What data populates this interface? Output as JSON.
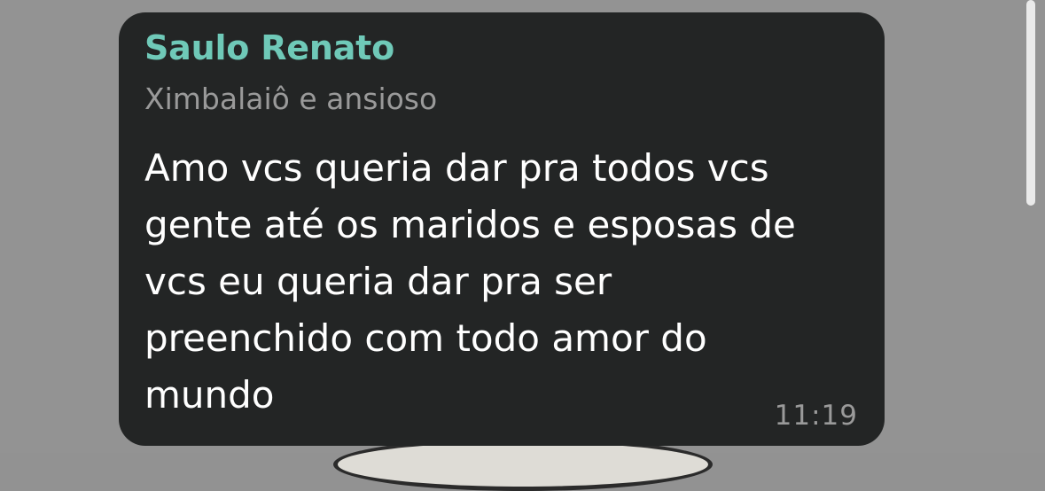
{
  "message": {
    "sender_name": "Saulo Renato",
    "sender_status": "Ximbalaiô e ansioso",
    "body_lines": [
      "Amo vcs queria dar pra todos vcs",
      "gente até os maridos e esposas de",
      "vcs eu queria dar pra ser",
      "preenchido com todo amor do",
      "mundo"
    ],
    "time": "11:19"
  },
  "colors": {
    "background": "#939393",
    "bubble": "#232525",
    "sender_name": "#6fc9b8",
    "secondary_text": "#9a9a9a",
    "body_text": "#ffffff"
  }
}
